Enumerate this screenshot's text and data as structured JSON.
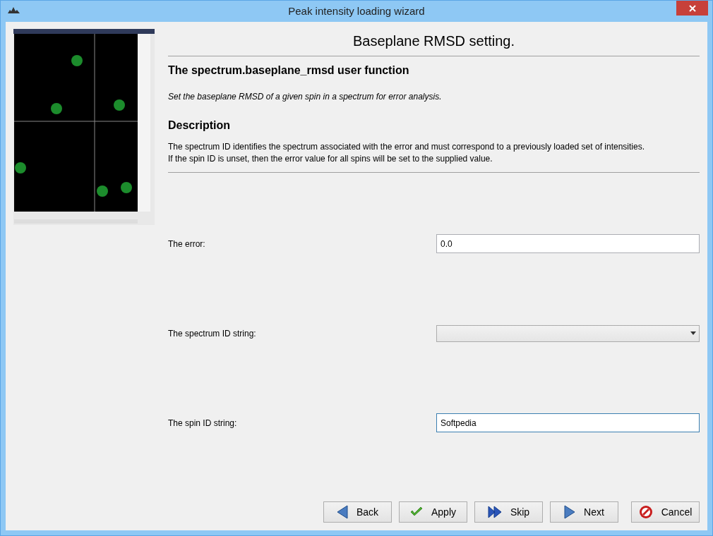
{
  "window": {
    "title": "Peak intensity loading wizard"
  },
  "page": {
    "heading": "Baseplane RMSD setting.",
    "subtitle": "The spectrum.baseplane_rmsd user function",
    "synopsis": "Set the baseplane RMSD of a given spin in a spectrum for error analysis.",
    "description_title": "Description",
    "description": [
      "The spectrum ID identifies the spectrum associated with the error and must correspond to a previously loaded set of intensities.",
      "If the spin ID is unset, then the error value for all spins will be set to the supplied value."
    ]
  },
  "fields": [
    {
      "kind": "text",
      "label": "The error:",
      "value": "0.0",
      "focused": false
    },
    {
      "kind": "dropdown",
      "label": "The spectrum ID string:"
    },
    {
      "kind": "text",
      "label": "The spin ID string:",
      "value": "Softpedia",
      "focused": true
    }
  ],
  "buttons": [
    {
      "kind": "back",
      "label": "Back"
    },
    {
      "kind": "apply",
      "label": "Apply"
    },
    {
      "kind": "skip",
      "label": "Skip"
    },
    {
      "kind": "next",
      "label": "Next"
    },
    {
      "kind": "cancel",
      "label": "Cancel"
    }
  ]
}
